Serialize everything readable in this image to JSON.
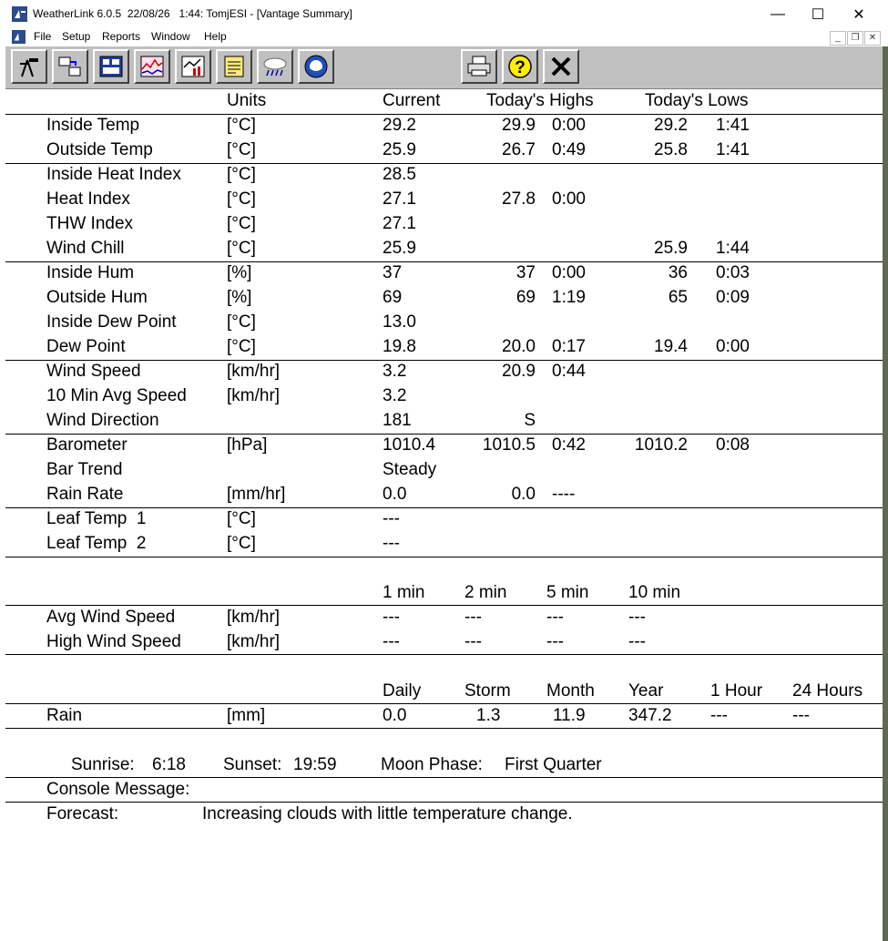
{
  "window": {
    "title": "WeatherLink 6.0.5  22/08/26   1:44: TomjESI - [Vantage Summary]",
    "controls": {
      "minimize": "—",
      "maximize": "☐",
      "close": "✕"
    }
  },
  "menu": [
    "File",
    "Setup",
    "Reports",
    "Window",
    "Help"
  ],
  "mdi_controls": [
    "_",
    "❐",
    "✕"
  ],
  "toolbar": {
    "left_buttons": [
      "weather-station-icon",
      "data-transfer-icon",
      "bulletin-icon",
      "strip-chart-icon",
      "graph-icon",
      "notes-icon",
      "rain-cloud-icon",
      "noaa-icon"
    ],
    "right_buttons": [
      "printer-icon",
      "help-icon",
      "close-icon"
    ]
  },
  "headers": {
    "units": "Units",
    "current": "Current",
    "highs": "Today's Highs",
    "lows": "Today's Lows"
  },
  "groups": [
    {
      "rows": [
        {
          "label": "Inside Temp",
          "unit": "[°C]",
          "current": "29.2",
          "high": "29.9",
          "high_time": "0:00",
          "low": "29.2",
          "low_time": "1:41"
        },
        {
          "label": "Outside Temp",
          "unit": "[°C]",
          "current": "25.9",
          "high": "26.7",
          "high_time": "0:49",
          "low": "25.8",
          "low_time": "1:41"
        }
      ]
    },
    {
      "rows": [
        {
          "label": "Inside Heat Index",
          "unit": "[°C]",
          "current": "28.5",
          "high": "",
          "high_time": "",
          "low": "",
          "low_time": ""
        },
        {
          "label": "Heat Index",
          "unit": "[°C]",
          "current": "27.1",
          "high": "27.8",
          "high_time": "0:00",
          "low": "",
          "low_time": ""
        },
        {
          "label": "THW Index",
          "unit": "[°C]",
          "current": "27.1",
          "high": "",
          "high_time": "",
          "low": "",
          "low_time": ""
        },
        {
          "label": "Wind Chill",
          "unit": "[°C]",
          "current": "25.9",
          "high": "",
          "high_time": "",
          "low": "25.9",
          "low_time": "1:44"
        }
      ]
    },
    {
      "rows": [
        {
          "label": "Inside Hum",
          "unit": "[%]",
          "current": "37",
          "high": "37",
          "high_time": "0:00",
          "low": "36",
          "low_time": "0:03"
        },
        {
          "label": "Outside Hum",
          "unit": "[%]",
          "current": "69",
          "high": "69",
          "high_time": "1:19",
          "low": "65",
          "low_time": "0:09"
        },
        {
          "label": "Inside Dew Point",
          "unit": "[°C]",
          "current": "13.0",
          "high": "",
          "high_time": "",
          "low": "",
          "low_time": ""
        },
        {
          "label": "Dew Point",
          "unit": "[°C]",
          "current": "19.8",
          "high": "20.0",
          "high_time": "0:17",
          "low": "19.4",
          "low_time": "0:00"
        }
      ]
    },
    {
      "rows": [
        {
          "label": "Wind Speed",
          "unit": "[km/hr]",
          "current": "3.2",
          "high": "20.9",
          "high_time": "0:44",
          "low": "",
          "low_time": ""
        },
        {
          "label": "10 Min Avg Speed",
          "unit": "[km/hr]",
          "current": "3.2",
          "high": "",
          "high_time": "",
          "low": "",
          "low_time": ""
        },
        {
          "label": "Wind Direction",
          "unit": "",
          "current": "181",
          "high": "S",
          "high_time": "",
          "low": "",
          "low_time": ""
        }
      ]
    },
    {
      "rows": [
        {
          "label": "Barometer",
          "unit": "[hPa]",
          "current": "1010.4",
          "high": "1010.5",
          "high_time": "0:42",
          "low": "1010.2",
          "low_time": "0:08"
        },
        {
          "label": "Bar Trend",
          "unit": "",
          "current": "Steady",
          "high": "",
          "high_time": "",
          "low": "",
          "low_time": ""
        },
        {
          "label": "Rain Rate",
          "unit": "[mm/hr]",
          "current": "0.0",
          "high": "0.0",
          "high_time": "----",
          "low": "",
          "low_time": ""
        }
      ]
    },
    {
      "rows": [
        {
          "label": "Leaf Temp  1",
          "unit": "[°C]",
          "current": "---",
          "high": "",
          "high_time": "",
          "low": "",
          "low_time": ""
        },
        {
          "label": "Leaf Temp  2",
          "unit": "[°C]",
          "current": "---",
          "high": "",
          "high_time": "",
          "low": "",
          "low_time": ""
        }
      ]
    }
  ],
  "wind_avg": {
    "headers": [
      "1 min",
      "2 min",
      "5 min",
      "10 min"
    ],
    "rows": [
      {
        "label": "Avg Wind Speed",
        "unit": "[km/hr]",
        "values": [
          "---",
          "---",
          "---",
          "---"
        ]
      },
      {
        "label": "High Wind Speed",
        "unit": "[km/hr]",
        "values": [
          "---",
          "---",
          "---",
          "---"
        ]
      }
    ]
  },
  "rain": {
    "headers": [
      "Daily",
      "Storm",
      "Month",
      "Year",
      "1 Hour",
      "24 Hours"
    ],
    "label": "Rain",
    "unit": "[mm]",
    "values": [
      "0.0",
      "1.3",
      "11.9",
      "347.2",
      "---",
      "---"
    ]
  },
  "sun_moon": {
    "sunrise_label": "Sunrise:",
    "sunrise": "6:18",
    "sunset_label": "Sunset:",
    "sunset": "19:59",
    "moon_label": "Moon Phase:",
    "moon": "First Quarter"
  },
  "console_message_label": "Console Message:",
  "forecast_label": "Forecast:",
  "forecast": "Increasing clouds with little temperature change."
}
